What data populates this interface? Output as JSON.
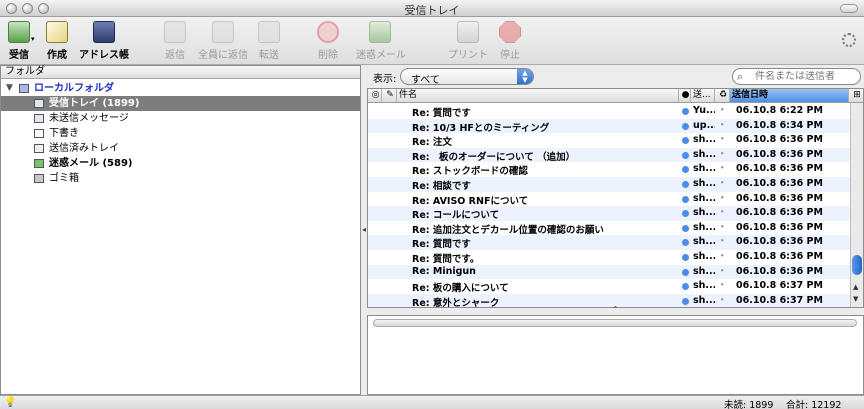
{
  "window": {
    "title": "受信トレイ"
  },
  "toolbar": {
    "get_mail": "受信",
    "compose": "作成",
    "address_book": "アドレス帳",
    "reply": "返信",
    "reply_all": "全員に返信",
    "forward": "転送",
    "delete": "削除",
    "junk": "迷惑メール",
    "print": "プリント",
    "stop": "停止"
  },
  "folders": {
    "header": "フォルダ",
    "items": [
      {
        "label": "ローカルフォルダ",
        "icon": "local-folders-icon"
      },
      {
        "label": "受信トレイ (1899)",
        "icon": "inbox-icon",
        "selected": true
      },
      {
        "label": "未送信メッセージ",
        "icon": "unsent-messages-icon"
      },
      {
        "label": "下書き",
        "icon": "drafts-icon"
      },
      {
        "label": "送信済みトレイ",
        "icon": "sent-icon"
      },
      {
        "label": "迷惑メール (589)",
        "icon": "junk-folder-icon"
      },
      {
        "label": "ゴミ箱",
        "icon": "trash-icon"
      }
    ]
  },
  "filter": {
    "show_label": "表示:",
    "view_value": "すべて",
    "search_placeholder": "件名または送信者"
  },
  "columns": {
    "subject": "件名",
    "sender": "送...",
    "date": "送信日時"
  },
  "messages": [
    {
      "subject": "Re: 質問です",
      "sender": "Yu...",
      "date": "06.10.8 6:22 PM"
    },
    {
      "subject": "Re: 10/3 HFとのミーティング",
      "sender": "up...",
      "date": "06.10.8 6:34 PM"
    },
    {
      "subject": "Re: 注文",
      "sender": "sh...",
      "date": "06.10.8 6:36 PM"
    },
    {
      "subject": "Re:　板のオーダーについて （追加）",
      "sender": "sh...",
      "date": "06.10.8 6:36 PM"
    },
    {
      "subject": "Re: ストックボードの確認",
      "sender": "sh...",
      "date": "06.10.8 6:36 PM"
    },
    {
      "subject": "Re: 相談です",
      "sender": "sh...",
      "date": "06.10.8 6:36 PM"
    },
    {
      "subject": "Re: AVISO RNFについて",
      "sender": "sh...",
      "date": "06.10.8 6:36 PM"
    },
    {
      "subject": "Re: コールについて",
      "sender": "sh...",
      "date": "06.10.8 6:36 PM"
    },
    {
      "subject": "Re: 追加注文とデカール位置の確認のお願い",
      "sender": "sh...",
      "date": "06.10.8 6:36 PM"
    },
    {
      "subject": "Re: 質問です",
      "sender": "sh...",
      "date": "06.10.8 6:36 PM"
    },
    {
      "subject": "Re: 質問です。",
      "sender": "sh...",
      "date": "06.10.8 6:36 PM"
    },
    {
      "subject": "Re: Minigun",
      "sender": "sh...",
      "date": "06.10.8 6:36 PM"
    },
    {
      "subject": "Re: 板の購入について",
      "sender": "sh...",
      "date": "06.10.8 6:37 PM"
    },
    {
      "subject": "Re: 意外とシャーク",
      "sender": "sh...",
      "date": "06.10.8 6:37 PM"
    }
  ],
  "status": {
    "unread": "未読: 1899",
    "total": "合計: 12192"
  },
  "colors": {
    "accent": "#4b8ce6",
    "selection": "#7d7d7d",
    "stripe": "#edf3fe"
  }
}
